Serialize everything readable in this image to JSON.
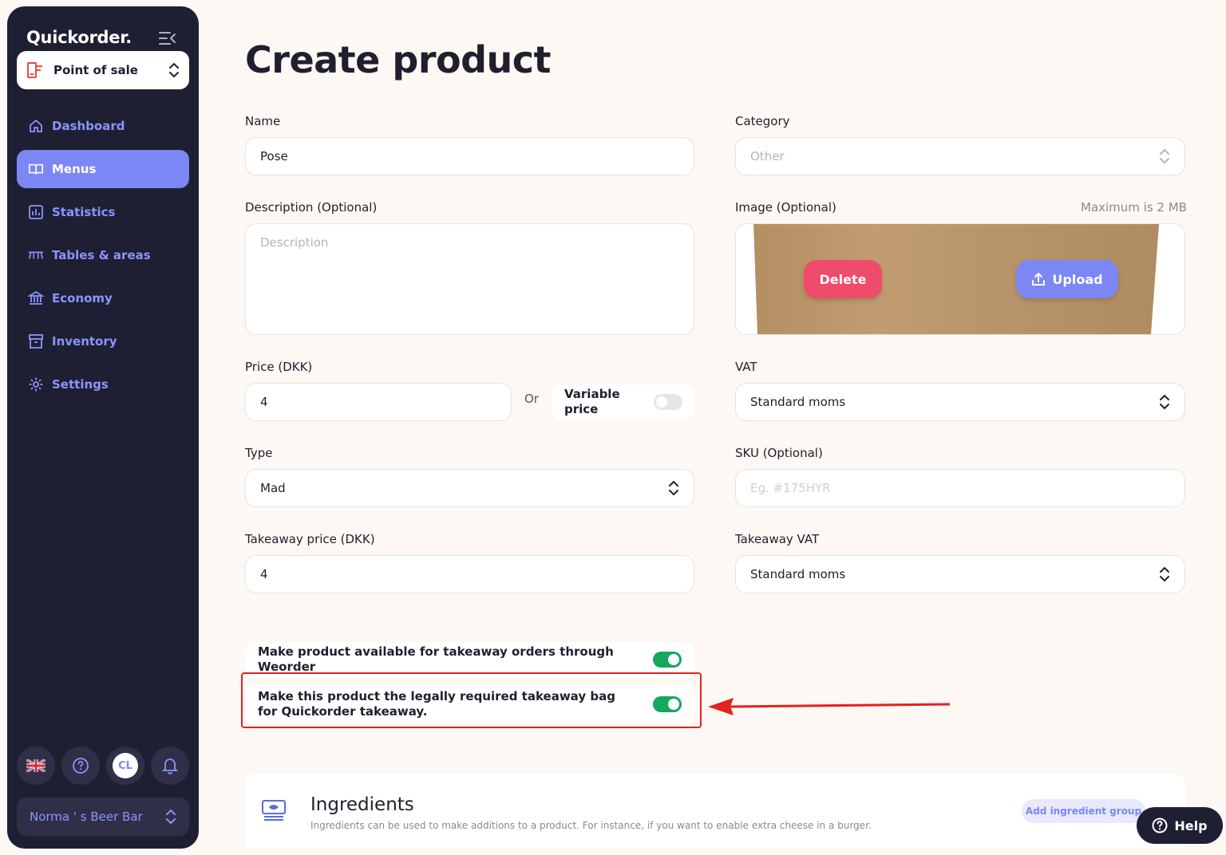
{
  "sidebar": {
    "brand": "Quickorder.",
    "pos_label": "Point of sale",
    "nav": [
      {
        "label": "Dashboard",
        "icon": "home-icon"
      },
      {
        "label": "Menus",
        "icon": "book-icon",
        "active": true
      },
      {
        "label": "Statistics",
        "icon": "chart-icon"
      },
      {
        "label": "Tables & areas",
        "icon": "table-icon"
      },
      {
        "label": "Economy",
        "icon": "bank-icon"
      },
      {
        "label": "Inventory",
        "icon": "archive-icon"
      },
      {
        "label": "Settings",
        "icon": "gear-icon"
      }
    ],
    "avatar": "CL",
    "venue": "Norma ' s Beer Bar"
  },
  "page": {
    "title": "Create product"
  },
  "form": {
    "name_label": "Name",
    "name_value": "Pose",
    "category_label": "Category",
    "category_value": "Other",
    "description_label": "Description (Optional)",
    "description_placeholder": "Description",
    "image_label": "Image (Optional)",
    "image_hint": "Maximum is 2 MB",
    "delete_label": "Delete",
    "upload_label": "Upload",
    "price_label": "Price (DKK)",
    "price_value": "4",
    "or_label": "Or",
    "variable_price_label": "Variable price",
    "vat_label": "VAT",
    "vat_value": "Standard moms",
    "type_label": "Type",
    "type_value": "Mad",
    "sku_label": "SKU (Optional)",
    "sku_placeholder": "Eg. #175HYR",
    "takeaway_price_label": "Takeaway price (DKK)",
    "takeaway_price_value": "4",
    "takeaway_vat_label": "Takeaway VAT",
    "takeaway_vat_value": "Standard moms",
    "option_takeaway": "Make product available for takeaway orders through Weorder",
    "option_bag": "Make this product the legally required takeaway bag for Quickorder takeaway."
  },
  "ingredients": {
    "title": "Ingredients",
    "description": "Ingredients can be used to make additions to a product. For instance, if you want to enable extra cheese in a burger.",
    "add_label": "Add ingredient group"
  },
  "help_label": "Help",
  "colors": {
    "sidebar_bg": "#1f1f33",
    "accent": "#7d86f5",
    "delete": "#ef4b6a",
    "toggle_on": "#14a85c",
    "annotation": "#e52020"
  }
}
